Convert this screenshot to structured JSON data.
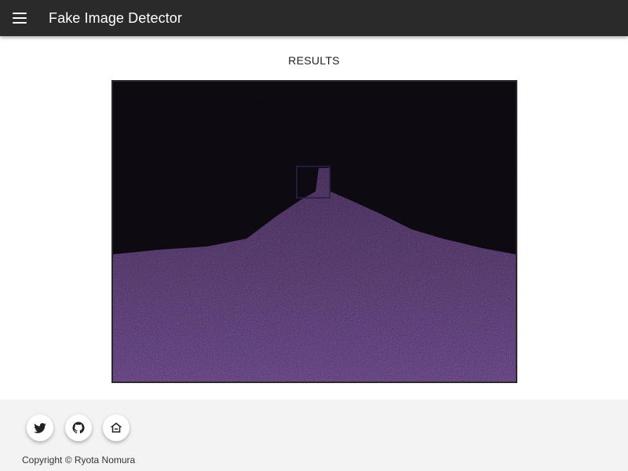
{
  "app": {
    "title": "Fake Image Detector"
  },
  "header": {
    "menu_icon": "hamburger-menu-icon"
  },
  "main": {
    "section_title": "RESULTS",
    "result_image": {
      "description_icon": "error-level-analysis-image"
    }
  },
  "footer": {
    "links": [
      {
        "icon": "twitter-icon"
      },
      {
        "icon": "github-icon"
      },
      {
        "icon": "home-icon"
      }
    ],
    "copyright": "Copyright © Ryota Nomura"
  },
  "colors": {
    "appbar": "#2a2a2a",
    "footer": "#f3f3f3",
    "icon": "#222222"
  }
}
